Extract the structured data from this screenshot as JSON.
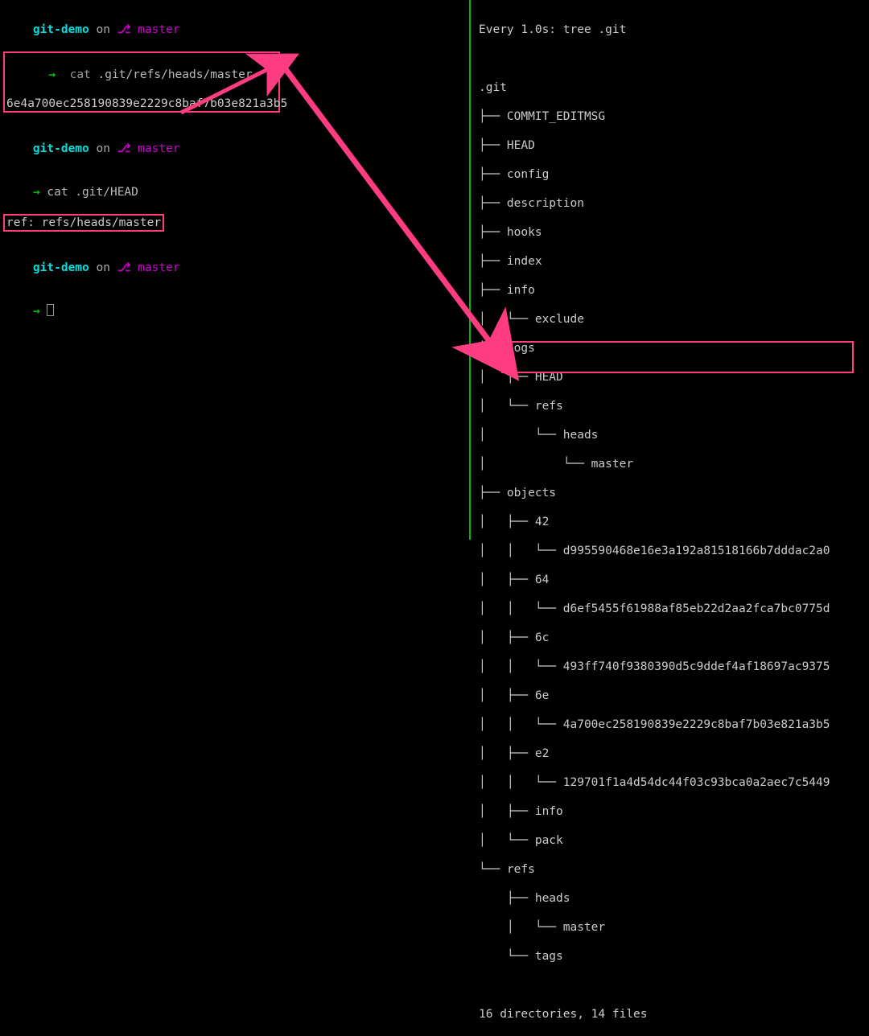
{
  "colors": {
    "highlight": "#ff3b82",
    "divider": "#0b0"
  },
  "left": {
    "prompt1": {
      "dir": "git-demo",
      "on": "on",
      "branch_sym": "⎇",
      "branch": "master"
    },
    "cmd1": {
      "arrow": "→",
      "cmd": "cat",
      "arg": ".git/refs/heads/master"
    },
    "out1": "6e4a700ec258190839e2229c8baf7b03e821a3b5",
    "prompt2": {
      "dir": "git-demo",
      "on": "on",
      "branch_sym": "⎇",
      "branch": "master"
    },
    "cmd2": {
      "arrow": "→",
      "full": "cat .git/HEAD"
    },
    "out2": "ref: refs/heads/master",
    "prompt3": {
      "dir": "git-demo",
      "on": "on",
      "branch_sym": "⎇",
      "branch": "master"
    },
    "arrow3": "→"
  },
  "right": {
    "header": "Every 1.0s: tree .git",
    "root": ".git",
    "l01": "├── COMMIT_EDITMSG",
    "l02": "├── HEAD",
    "l03": "├── config",
    "l04": "├── description",
    "l05": "├── hooks",
    "l06": "├── index",
    "l07": "├── info",
    "l08": "│   └── exclude",
    "l09": "├── logs",
    "l10": "│   ├── HEAD",
    "l11": "│   └── refs",
    "l12": "│       └── heads",
    "l13": "│           └── master",
    "l14": "├── objects",
    "l15": "│   ├── 42",
    "l16": "│   │   └── d995590468e16e3a192a81518166b7dddac2a0",
    "l17": "│   ├── 64",
    "l18": "│   │   └── d6ef5455f61988af85eb22d2aa2fca7bc0775d",
    "l19": "│   ├── 6c",
    "l20": "│   │   └── 493ff740f9380390d5c9ddef4af18697ac9375",
    "l21": "│   ├── 6e",
    "l22": "│   │   └── 4a700ec258190839e2229c8baf7b03e821a3b5",
    "l23": "│   ├── e2",
    "l24": "│   │   └── 129701f1a4d54dc44f03c93bca0a2aec7c5449",
    "l25": "│   ├── info",
    "l26": "│   └── pack",
    "l27": "└── refs",
    "l28": "    ├── heads",
    "l29": "    │   └── master",
    "l30": "    └── tags",
    "summary": "16 directories, 14 files"
  }
}
